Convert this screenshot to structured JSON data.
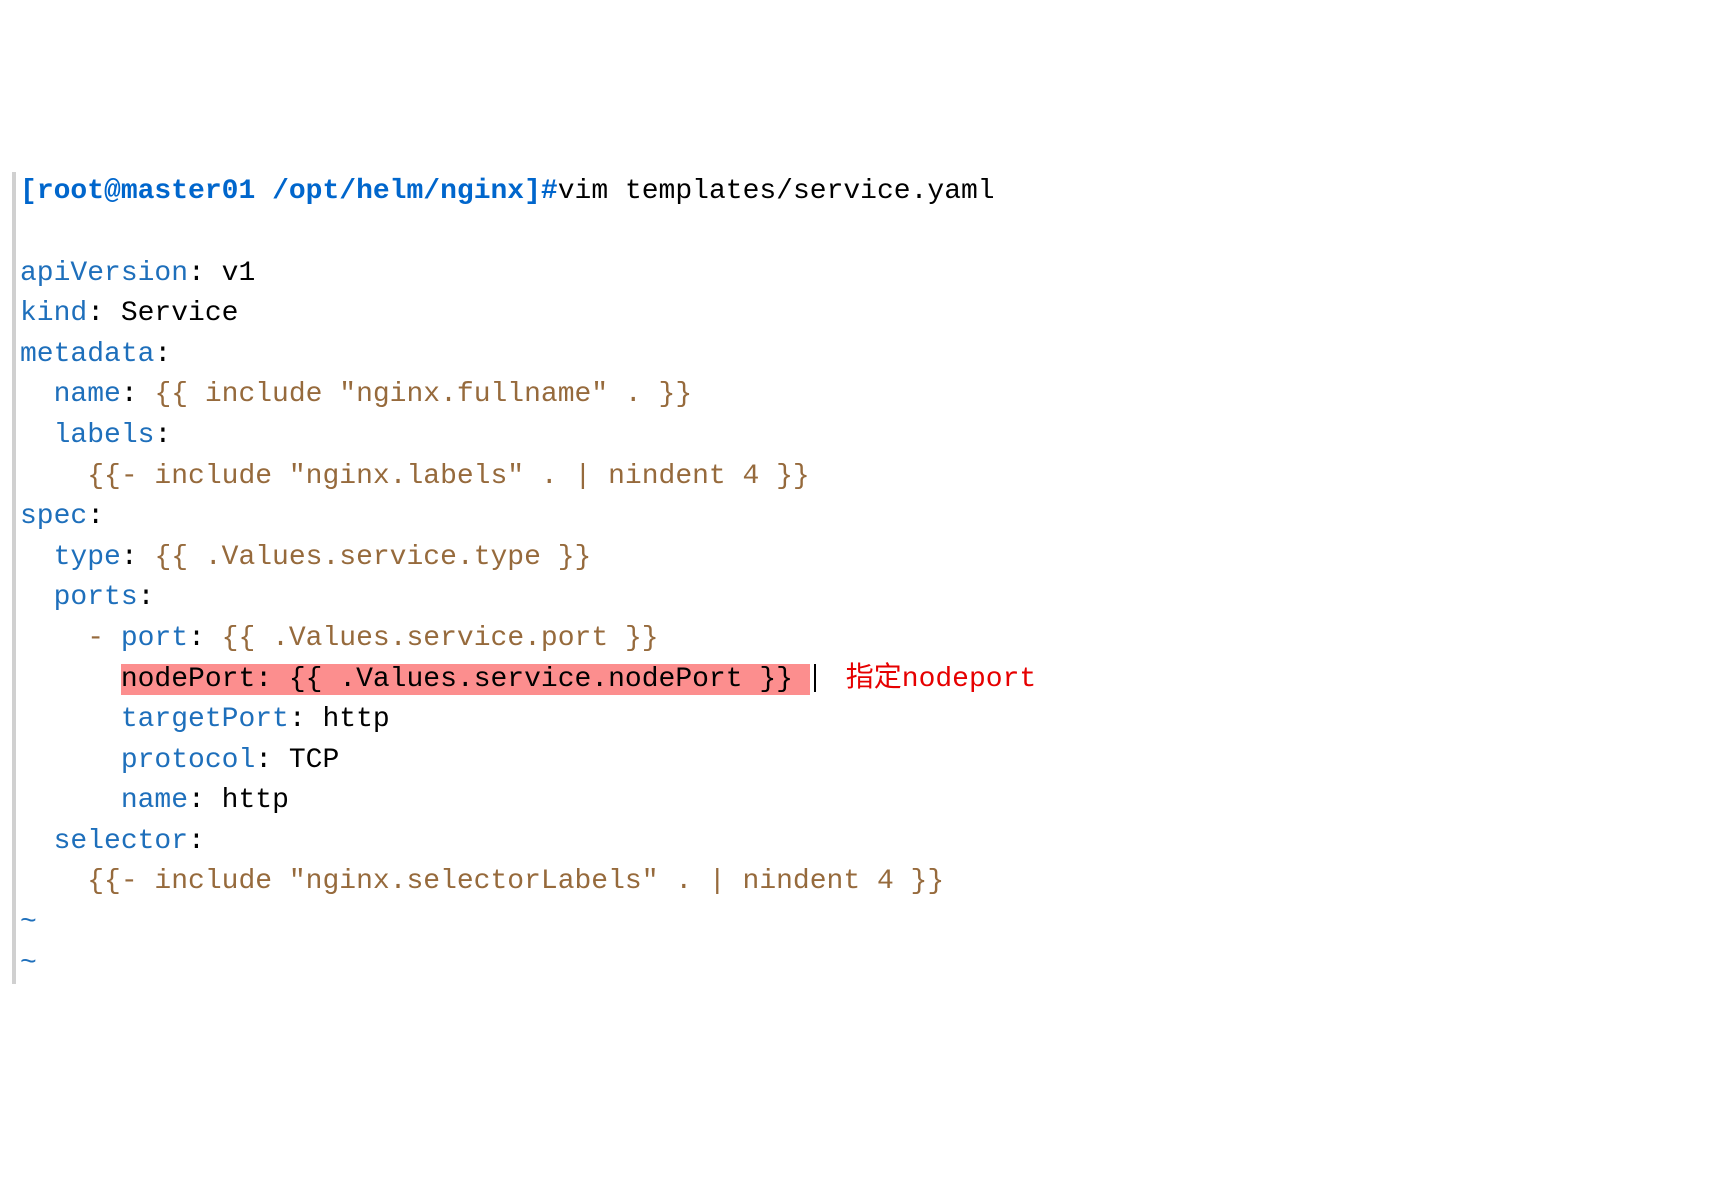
{
  "prompt": {
    "bracket_open": "[",
    "user_host": "root@master01",
    "path": "/opt/helm/nginx",
    "bracket_close": "]",
    "hash": "#"
  },
  "command": "vim templates/service.yaml",
  "yaml": {
    "apiVersion": {
      "key": "apiVersion",
      "val": "v1"
    },
    "kind": {
      "key": "kind",
      "val": "Service"
    },
    "metadata": {
      "key": "metadata"
    },
    "name": {
      "key": "name",
      "tmpl": "{{ include \"nginx.fullname\" . }}"
    },
    "labels": {
      "key": "labels"
    },
    "labels_tmpl": "{{- include \"nginx.labels\" . | nindent 4 }}",
    "spec": {
      "key": "spec"
    },
    "type": {
      "key": "type",
      "tmpl": "{{ .Values.service.type }}"
    },
    "ports": {
      "key": "ports"
    },
    "port": {
      "dash": "-",
      "key": "port",
      "tmpl": "{{ .Values.service.port }}"
    },
    "nodePort": {
      "key": "nodePort",
      "tmpl": "{{ .Values.service.nodePort }}"
    },
    "targetPort": {
      "key": "targetPort",
      "val": "http"
    },
    "protocol": {
      "key": "protocol",
      "val": "TCP"
    },
    "name2": {
      "key": "name",
      "val": "http"
    },
    "selector": {
      "key": "selector"
    },
    "selector_tmpl": "{{- include \"nginx.selectorLabels\" . | nindent 4 }}"
  },
  "annotation": "指定nodeport",
  "tilde": "~"
}
